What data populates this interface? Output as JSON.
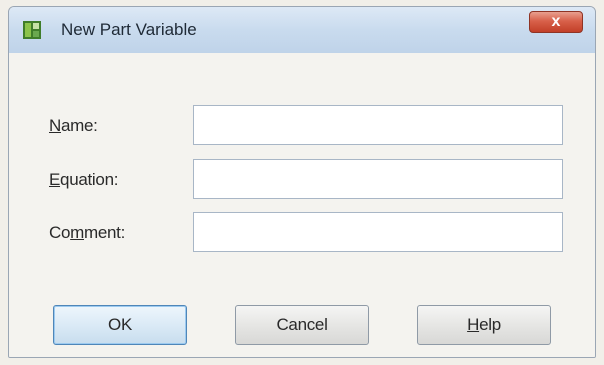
{
  "window": {
    "title": "New Part Variable",
    "close_glyph": "x",
    "icon": "variable-table-icon"
  },
  "form": {
    "name": {
      "label_underlined": "N",
      "label_rest": "ame:",
      "value": ""
    },
    "equation": {
      "label_underlined": "E",
      "label_rest": "quation:",
      "value": ""
    },
    "comment": {
      "label_pre": "Co",
      "label_underlined": "m",
      "label_rest": "ment:",
      "value": ""
    }
  },
  "buttons": {
    "ok": "OK",
    "cancel": "Cancel",
    "help_underlined": "H",
    "help_rest": "elp"
  },
  "colors": {
    "titlebar": "#c9dbee",
    "close_button": "#d8604a",
    "default_button_border": "#4f86b8"
  }
}
